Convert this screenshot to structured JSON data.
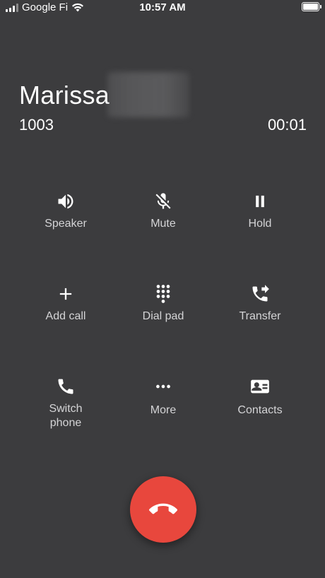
{
  "status_bar": {
    "carrier": "Google Fi",
    "time": "10:57 AM",
    "icons": [
      "signal-icon",
      "wifi-icon",
      "battery-icon"
    ]
  },
  "call": {
    "caller_name": "Marissa",
    "extension": "1003",
    "timer": "00:01"
  },
  "actions": [
    {
      "label": "Speaker",
      "icon": "speaker-icon"
    },
    {
      "label": "Mute",
      "icon": "mic-off-icon"
    },
    {
      "label": "Hold",
      "icon": "pause-icon"
    },
    {
      "label": "Add call",
      "icon": "plus-icon"
    },
    {
      "label": "Dial pad",
      "icon": "dialpad-icon"
    },
    {
      "label": "Transfer",
      "icon": "phone-forward-icon"
    },
    {
      "label": "Switch phone",
      "icon": "phone-icon"
    },
    {
      "label": "More",
      "icon": "more-dots-icon"
    },
    {
      "label": "Contacts",
      "icon": "contact-card-icon"
    }
  ],
  "colors": {
    "background": "#3c3c3e",
    "hangup": "#e8473d",
    "label": "#d4d4d6"
  }
}
